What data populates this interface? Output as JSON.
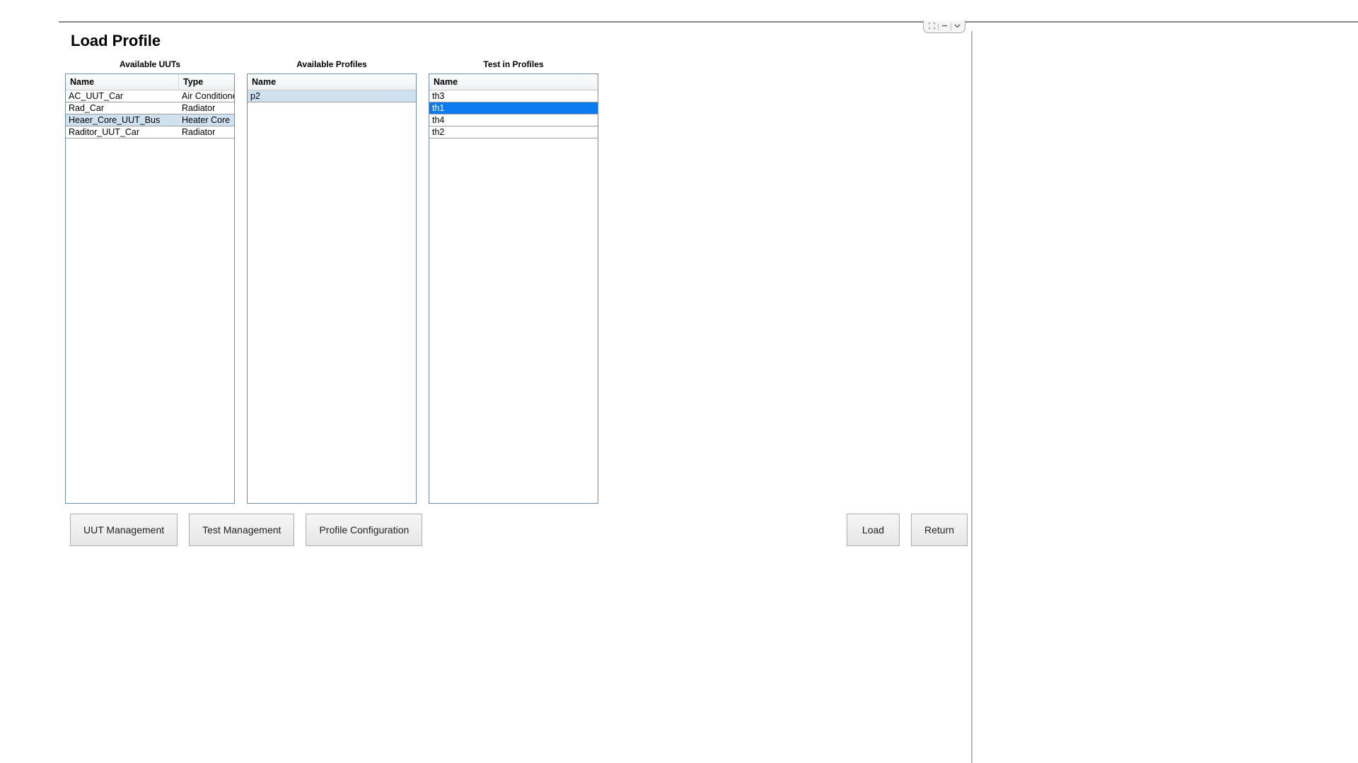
{
  "title": "Load Profile",
  "panels": {
    "uuts": {
      "title": "Available UUTs",
      "columns": {
        "name": "Name",
        "type": "Type"
      },
      "rows": [
        {
          "name": "AC_UUT_Car",
          "type": "Air Conditioner",
          "selected": false
        },
        {
          "name": "Rad_Car",
          "type": "Radiator",
          "selected": false
        },
        {
          "name": "Heaer_Core_UUT_Bus",
          "type": "Heater Core",
          "selected": true
        },
        {
          "name": "Raditor_UUT_Car",
          "type": "Radiator",
          "selected": false
        }
      ]
    },
    "profiles": {
      "title": "Available Profiles",
      "columns": {
        "name": "Name"
      },
      "rows": [
        {
          "name": "p2",
          "selected": true
        }
      ]
    },
    "tests": {
      "title": "Test in Profiles",
      "columns": {
        "name": "Name"
      },
      "rows": [
        {
          "name": "th3",
          "selected": false
        },
        {
          "name": "th1",
          "selected": true
        },
        {
          "name": "th4",
          "selected": false
        },
        {
          "name": "th2",
          "selected": false
        }
      ]
    }
  },
  "buttons": {
    "uut_management": "UUT Management",
    "test_management": "Test Management",
    "profile_configuration": "Profile Configuration",
    "load": "Load",
    "return": "Return"
  },
  "window_controls": {
    "expand": "⛶",
    "minimize": "—",
    "dropdown": "﹀"
  }
}
